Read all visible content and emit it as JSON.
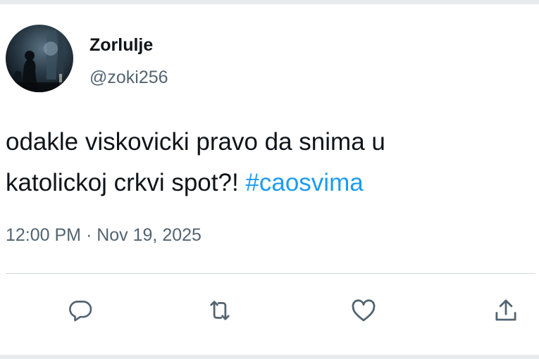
{
  "tweet": {
    "author": {
      "display_name": "Zorlulje",
      "handle": "@zoki256"
    },
    "text": {
      "line1": "odakle viskovicki pravo da snima u",
      "line2": "katolickoj crkvi spot?!",
      "hashtag": "#caosvima"
    },
    "timestamp": "12:00 PM · Nov 19, 2025",
    "actions": [
      {
        "icon": "reply-icon"
      },
      {
        "icon": "retweet-icon"
      },
      {
        "icon": "like-icon"
      },
      {
        "icon": "share-icon"
      }
    ]
  },
  "colors": {
    "text_primary": "#0f1419",
    "text_secondary": "#536471",
    "link": "#1d9bf0",
    "divider": "#cfd9de"
  }
}
